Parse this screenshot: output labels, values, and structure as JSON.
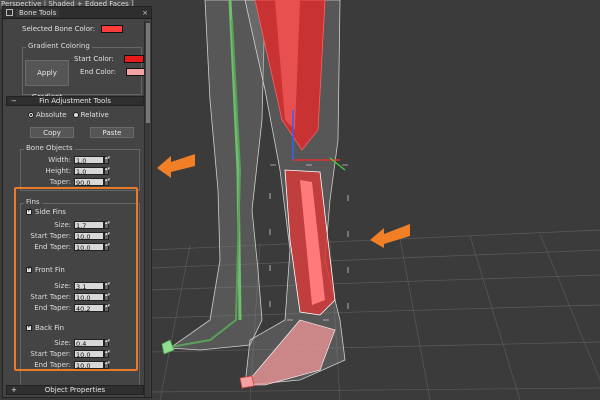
{
  "window": {
    "title": "Bone Tools",
    "viewport_caption": "Perspective | Shaded + Edged Faces ]"
  },
  "color_section": {
    "selected_bone_color_label": "Selected Bone Color:",
    "selected_bone_color": "#ff3b3b",
    "gradient_group_label": "Gradient Coloring",
    "apply_gradient_label": "Apply Gradient",
    "start_color_label": "Start Color:",
    "start_color": "#e81a1a",
    "end_color_label": "End Color:",
    "end_color": "#f4a3a3"
  },
  "fin_tools": {
    "rollout_label": "Fin Adjustment Tools",
    "absolute_label": "Absolute",
    "relative_label": "Relative",
    "copy_label": "Copy",
    "paste_label": "Paste"
  },
  "bone_objects": {
    "group_label": "Bone Objects",
    "width_label": "Width:",
    "width_value": "1.0",
    "height_label": "Height:",
    "height_value": "1.0",
    "taper_label": "Taper:",
    "taper_value": "90.0"
  },
  "fins": {
    "group_label": "Fins",
    "side": {
      "label": "Side Fins",
      "size_label": "Size:",
      "size_value": "1.7",
      "start_taper_label": "Start Taper:",
      "start_taper_value": "10.0",
      "end_taper_label": "End Taper:",
      "end_taper_value": "10.0"
    },
    "front": {
      "label": "Front Fin",
      "size_label": "Size:",
      "size_value": "3.1",
      "start_taper_label": "Start Taper:",
      "start_taper_value": "10.0",
      "end_taper_label": "End Taper:",
      "end_taper_value": "40.2"
    },
    "back": {
      "label": "Back Fin",
      "size_label": "Size:",
      "size_value": "0.4",
      "start_taper_label": "Start Taper:",
      "start_taper_value": "10.0",
      "end_taper_label": "End Taper:",
      "end_taper_value": "10.0"
    }
  },
  "object_properties_label": "Object Properties",
  "colors": {
    "highlight": "#e87a2a",
    "arrow": "#f07f26",
    "bone_red": "#d43a3a",
    "bone_green": "#5aa05a"
  }
}
